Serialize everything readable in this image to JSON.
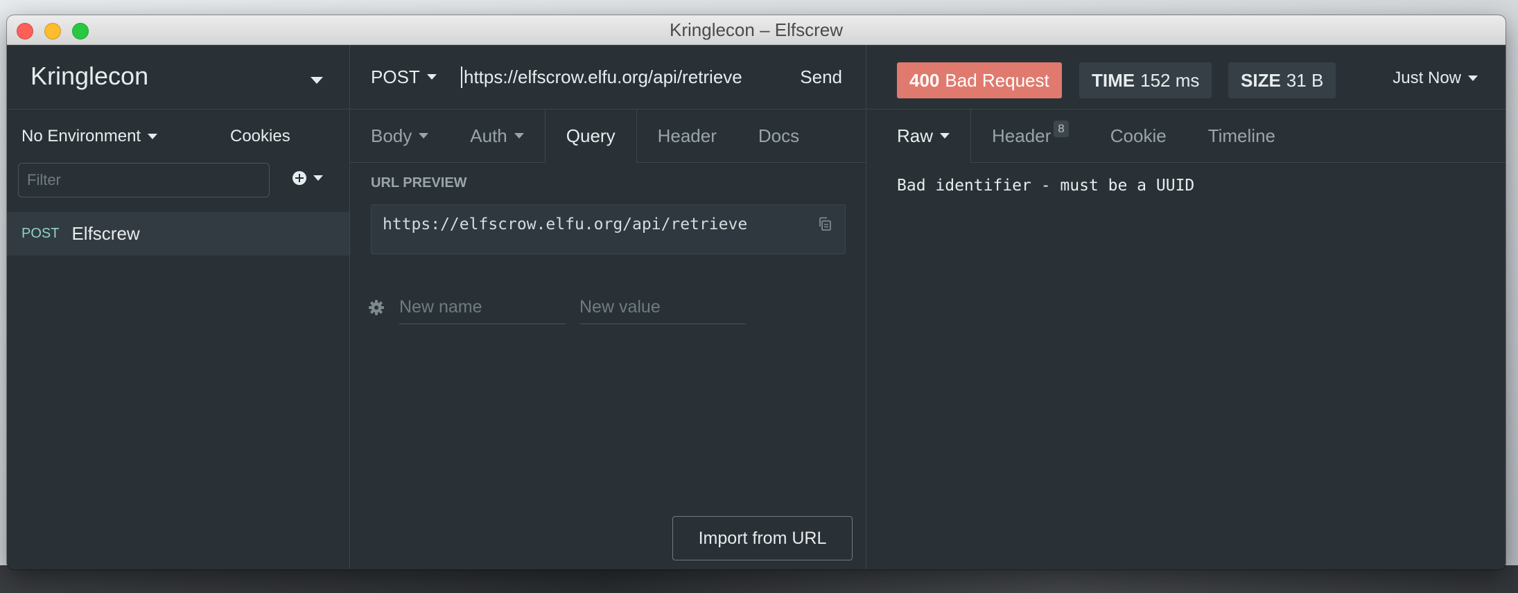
{
  "window": {
    "title": "Kringlecon – Elfscrew"
  },
  "sidebar": {
    "workspace": "Kringlecon",
    "environment": "No Environment",
    "cookies": "Cookies",
    "filter_placeholder": "Filter",
    "requests": [
      {
        "method": "POST",
        "name": "Elfscrew"
      }
    ]
  },
  "request": {
    "method": "POST",
    "url": "https://elfscrow.elfu.org/api/retrieve",
    "send_label": "Send",
    "tabs": [
      {
        "label": "Body"
      },
      {
        "label": "Auth"
      },
      {
        "label": "Query"
      },
      {
        "label": "Header"
      },
      {
        "label": "Docs"
      }
    ],
    "url_preview_label": "URL PREVIEW",
    "url_preview": "https://elfscrow.elfu.org/api/retrieve",
    "param_name_placeholder": "New name",
    "param_value_placeholder": "New value",
    "import_label": "Import from URL"
  },
  "response": {
    "status_code": "400",
    "status_text": "Bad Request",
    "time_label": "TIME",
    "time_value": "152 ms",
    "size_label": "SIZE",
    "size_value": "31 B",
    "history_label": "Just Now",
    "tabs": [
      {
        "label": "Raw"
      },
      {
        "label": "Header",
        "count": "8"
      },
      {
        "label": "Cookie"
      },
      {
        "label": "Timeline"
      }
    ],
    "body": "Bad identifier - must be a UUID"
  },
  "colors": {
    "background": "#293136",
    "status_error": "#e07a6e",
    "method_post": "#8fd4c4"
  }
}
